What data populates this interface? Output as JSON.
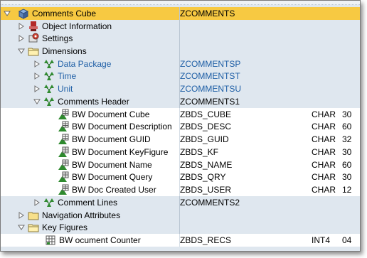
{
  "rows": [
    {
      "name": "Comments Cube",
      "tech": "ZCOMMENTS",
      "type": "",
      "len": ""
    },
    {
      "name": "Object Information",
      "tech": "",
      "type": "",
      "len": ""
    },
    {
      "name": "Settings",
      "tech": "",
      "type": "",
      "len": ""
    },
    {
      "name": "Dimensions",
      "tech": "",
      "type": "",
      "len": ""
    },
    {
      "name": "Data Package",
      "tech": "ZCOMMENTSP",
      "type": "",
      "len": ""
    },
    {
      "name": "Time",
      "tech": "ZCOMMENTST",
      "type": "",
      "len": ""
    },
    {
      "name": "Unit",
      "tech": "ZCOMMENTSU",
      "type": "",
      "len": ""
    },
    {
      "name": "Comments Header",
      "tech": "ZCOMMENTS1",
      "type": "",
      "len": ""
    },
    {
      "name": "BW Document Cube",
      "tech": "ZBDS_CUBE",
      "type": "CHAR",
      "len": "30"
    },
    {
      "name": "BW Document Description",
      "tech": "ZBDS_DESC",
      "type": "CHAR",
      "len": "60"
    },
    {
      "name": "BW Document GUID",
      "tech": "ZBDS_GUID",
      "type": "CHAR",
      "len": "32"
    },
    {
      "name": "BW Document KeyFigure",
      "tech": "ZBDS_KF",
      "type": "CHAR",
      "len": "30"
    },
    {
      "name": "BW Document Name",
      "tech": "ZBDS_NAME",
      "type": "CHAR",
      "len": "60"
    },
    {
      "name": "BW Document Query",
      "tech": "ZBDS_QRY",
      "type": "CHAR",
      "len": "30"
    },
    {
      "name": "BW Doc Created User",
      "tech": "ZBDS_USER",
      "type": "CHAR",
      "len": "12"
    },
    {
      "name": "Comment Lines",
      "tech": "ZCOMMENTS2",
      "type": "",
      "len": ""
    },
    {
      "name": "Navigation Attributes",
      "tech": "",
      "type": "",
      "len": ""
    },
    {
      "name": "Key Figures",
      "tech": "",
      "type": "",
      "len": ""
    },
    {
      "name": "BW ocument Counter",
      "tech": "ZBDS_RECS",
      "type": "INT4",
      "len": "04"
    }
  ],
  "icons": {
    "cube": "cube-icon",
    "info": "object-info-icon",
    "settings": "settings-icon",
    "folder": "folder-icon",
    "open_folder": "open-folder-icon",
    "dimension": "dimension-icon",
    "characteristic": "characteristic-icon",
    "keyfigure": "keyfigure-icon"
  },
  "colors": {
    "selected": "#f7c942",
    "row_blue": "#dfe7ef",
    "row_white": "#ffffff",
    "link": "#1f5fa6"
  }
}
